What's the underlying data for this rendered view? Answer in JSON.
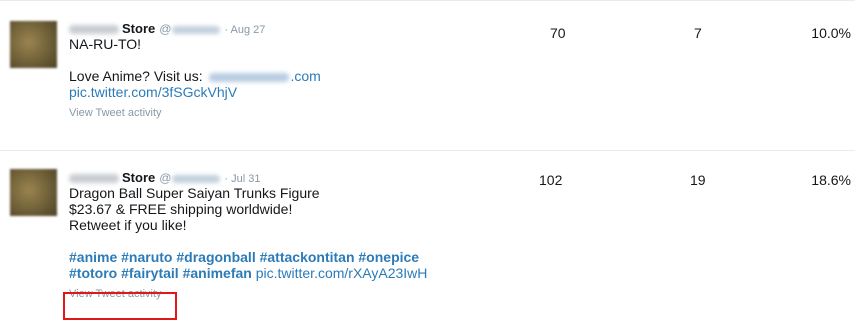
{
  "tweets": [
    {
      "account_name": "Store",
      "handle_prefix": "@",
      "date": "· Aug 27",
      "lines": [
        "NA-RU-TO!",
        "",
        "Love Anime? Visit us:"
      ],
      "visit_suffix": ".com",
      "pic_link": "pic.twitter.com/3fSGckVhjV",
      "activity_label": "View Tweet activity",
      "impressions": "70",
      "engagements": "7",
      "engagement_rate": "10.0%"
    },
    {
      "account_name": "Store",
      "handle_prefix": "@",
      "date": "· Jul 31",
      "lines": [
        "Dragon Ball Super Saiyan Trunks Figure",
        "$23.67 & FREE shipping worldwide!",
        "Retweet if you like!"
      ],
      "hashtags_line1": "#anime #naruto #dragonball #attackontitan #onepice",
      "hashtags_line2": "#totoro #fairytail #animefan",
      "pic_link": "pic.twitter.com/rXAyA23IwH",
      "activity_label": "View Tweet activity",
      "impressions": "102",
      "engagements": "19",
      "engagement_rate": "18.6%"
    }
  ],
  "colors": {
    "link": "#2b7bb9",
    "muted": "#8899a6",
    "highlight": "#e01818",
    "divider": "#e6ecf0"
  }
}
